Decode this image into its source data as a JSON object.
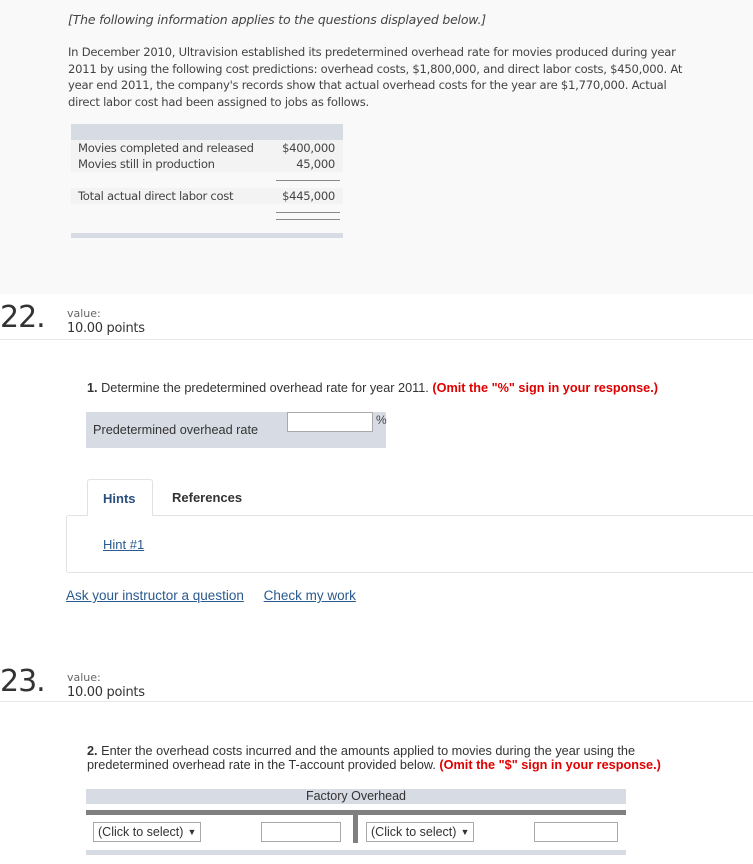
{
  "info": {
    "intro": "[The following information applies to the questions displayed below.]",
    "paragraph": "In December 2010, Ultravision established its predetermined overhead rate for movies produced during year 2011 by using the following cost predictions: overhead costs, $1,800,000, and direct labor costs, $450,000. At year end 2011, the company's records show that actual overhead costs for the year are $1,770,000. Actual direct labor cost had been assigned to jobs as follows.",
    "labor_table": {
      "rows": [
        {
          "label": "Movies completed and released",
          "amount": "$400,000"
        },
        {
          "label": "Movies still in production",
          "amount": "45,000"
        }
      ],
      "total": {
        "label": "Total actual direct labor cost",
        "amount": "$445,000"
      }
    }
  },
  "questions": [
    {
      "number": "22.",
      "value_label": "value:",
      "points": "10.00 points",
      "prompt_num": "1.",
      "prompt_text": " Determine the predetermined overhead rate for year 2011. ",
      "prompt_warning": "(Omit the \"%\" sign in your response.)",
      "field_label": "Predetermined overhead rate",
      "field_value": "",
      "field_unit": "%",
      "tabs": [
        {
          "label": "Hints",
          "active": true
        },
        {
          "label": "References",
          "active": false
        }
      ],
      "hint_link": "Hint #1",
      "links": {
        "ask": "Ask your instructor a question",
        "check": "Check my work"
      }
    },
    {
      "number": "23.",
      "value_label": "value:",
      "points": "10.00 points",
      "prompt_num": "2.",
      "prompt_text": " Enter the overhead costs incurred and the amounts applied to movies during the year using the predetermined overhead rate in the T-account provided below. ",
      "prompt_warning": "(Omit the \"$\" sign in your response.)",
      "t_account": {
        "title": "Factory Overhead",
        "left_select": "(Click to select)",
        "left_value": "",
        "right_select": "(Click to select)",
        "right_value": ""
      }
    }
  ],
  "colors": {
    "warning": "#e00000",
    "link": "#2a5a8f",
    "panel": "#d7dbe4"
  }
}
